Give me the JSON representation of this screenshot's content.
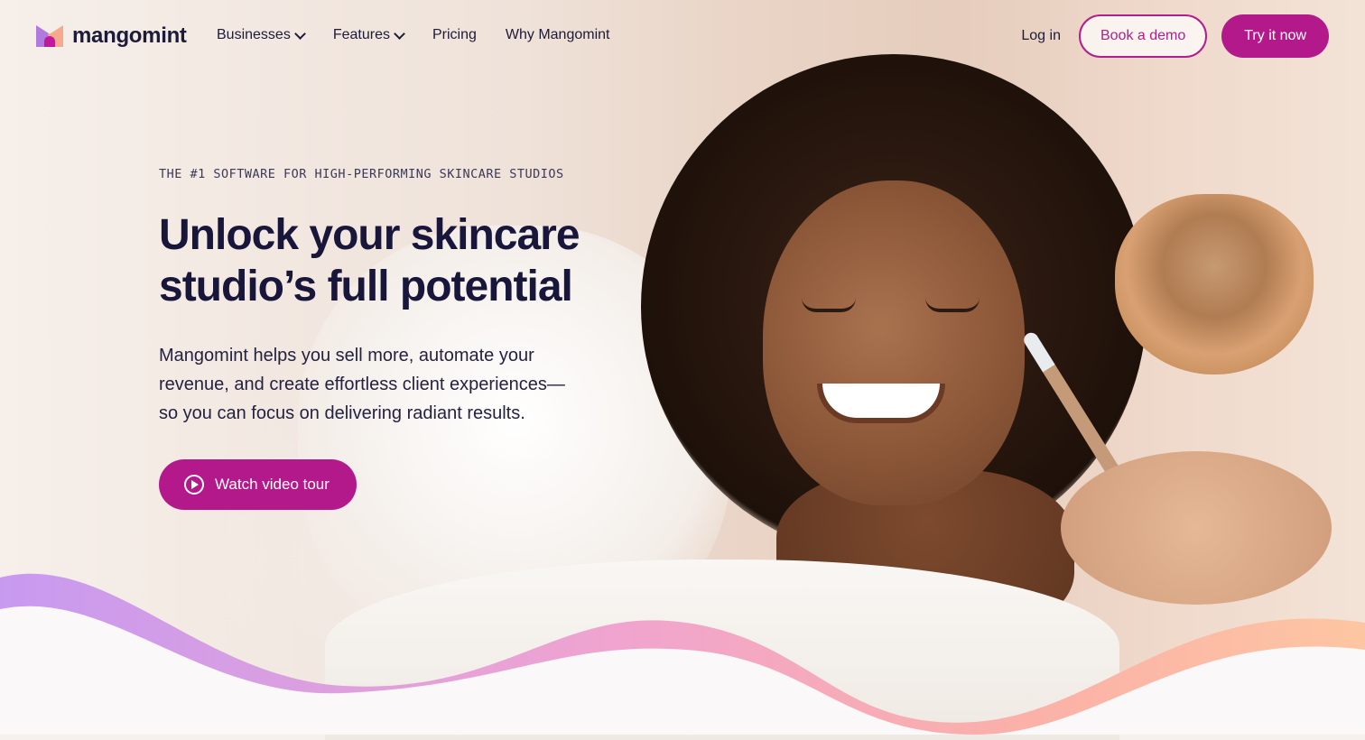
{
  "brand": {
    "name": "mangomint",
    "accent": "#b4198c"
  },
  "nav": {
    "items": [
      {
        "label": "Businesses",
        "dropdown": true
      },
      {
        "label": "Features",
        "dropdown": true
      },
      {
        "label": "Pricing",
        "dropdown": false
      },
      {
        "label": "Why Mangomint",
        "dropdown": false
      }
    ],
    "login": "Log in",
    "book_demo": "Book a demo",
    "try_now": "Try it now"
  },
  "hero": {
    "eyebrow": "THE #1 SOFTWARE FOR HIGH-PERFORMING SKINCARE STUDIOS",
    "headline": "Unlock your skincare studio’s full potential",
    "subtext": "Mangomint helps you sell more, automate your revenue, and create effortless client experiences—so you can focus on delivering radiant results.",
    "cta": "Watch video tour",
    "cta_icon": "play-circle-icon"
  },
  "wave_colors": [
    "#c79af0",
    "#f0a4cf",
    "#fbb0a8",
    "#fdc6a2"
  ]
}
